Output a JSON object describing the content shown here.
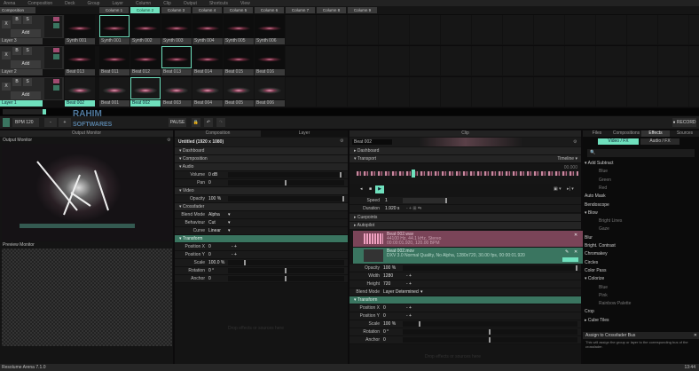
{
  "menu": [
    "Arena",
    "Composition",
    "Deck",
    "Group",
    "Layer",
    "Column",
    "Clip",
    "Output",
    "Shortcuts",
    "View"
  ],
  "composition_label": "Composition",
  "columns": [
    "Column 1",
    "Column 2",
    "Column 3",
    "Column 4",
    "Column 5",
    "Column 6",
    "Column 7",
    "Column 8",
    "Column 9"
  ],
  "selected_column": 1,
  "layers": [
    {
      "name": "Layer 3",
      "blend": "Add",
      "current": "Synth 001",
      "clips": [
        "Synth 001",
        "Synth 002",
        "Synth 003",
        "Synth 004",
        "Synth 005",
        "Synth 006"
      ],
      "selected_clip": 0,
      "active": false
    },
    {
      "name": "Layer 2",
      "blend": "Add",
      "current": "Beat 013",
      "clips": [
        "Beat 011",
        "Beat 012",
        "Beat 013",
        "Beat 014",
        "Beat 015",
        "Beat 016"
      ],
      "selected_clip": 2,
      "active": false
    },
    {
      "name": "Layer 1",
      "blend": "Add",
      "current": "Beat 002",
      "clips": [
        "Beat 001",
        "Beat 002",
        "Beat 003",
        "Beat 004",
        "Beat 005",
        "Beat 006"
      ],
      "selected_clip": 1,
      "active": true
    }
  ],
  "layer_buttons": {
    "bypass": "B",
    "solo": "S",
    "x": "X"
  },
  "toolbar": {
    "bpm_label": "BPM",
    "bpm": "120",
    "minus": "-",
    "plus": "+",
    "pause": "PAUSE",
    "record": "RECORD"
  },
  "monitor": {
    "tab": "Output Monitor",
    "output_title": "Output Monitor",
    "preview_title": "Preview Monitor"
  },
  "comp_panel": {
    "tabs": [
      "Composition",
      "Layer"
    ],
    "title": "Untitled (1920 x 1080)",
    "rows": [
      {
        "t": "sec",
        "label": "Dashboard"
      },
      {
        "t": "sec",
        "label": "Composition"
      },
      {
        "t": "sec",
        "label": "Audio"
      },
      {
        "t": "param",
        "label": "Volume",
        "value": "0 dB",
        "knob": 0.98
      },
      {
        "t": "param",
        "label": "Pan",
        "value": "0",
        "knob": 0.5
      },
      {
        "t": "sec",
        "label": "Video"
      },
      {
        "t": "param",
        "label": "Opacity",
        "value": "100 %",
        "knob": 1
      },
      {
        "t": "sec",
        "label": "Crossfader"
      },
      {
        "t": "drop",
        "label": "Blend Mode",
        "value": "Alpha"
      },
      {
        "t": "drop",
        "label": "Behaviour",
        "value": "Cut"
      },
      {
        "t": "drop",
        "label": "Curve",
        "value": "Linear"
      },
      {
        "t": "green",
        "label": "Transform"
      },
      {
        "t": "pm",
        "label": "Position X",
        "value": "0"
      },
      {
        "t": "pm",
        "label": "Position Y",
        "value": "0"
      },
      {
        "t": "param",
        "label": "Scale",
        "value": "100.0 %",
        "knob": 0.15
      },
      {
        "t": "param",
        "label": "Rotation",
        "value": "0 °",
        "knob": 0.5
      },
      {
        "t": "param",
        "label": "Anchor",
        "value": "0",
        "knob": 0.5
      }
    ],
    "drop_hint": "Drop effects or sources here"
  },
  "clip_panel": {
    "tab": "Clip",
    "name": "Beat 002",
    "dashboard": "Dashboard",
    "transport": "Transport",
    "timeline": "Timeline",
    "time": "00.000",
    "speed_label": "Speed",
    "speed": "1",
    "duration_label": "Duration",
    "duration": "1.920 s",
    "cuepoints": "Cuepoints",
    "autopilot": "Autopilot",
    "audio_item": {
      "name": "Beat 002.wav",
      "l1": "44100 Hz, 44.1 kHz, Stereo",
      "l2": "00:00:01.920, 120.00 BPM"
    },
    "video_item": {
      "name": "Beat 002.mov",
      "l1": "DXV 3.0 Normal Quality, No Alpha, 1280x720, 30.00 fps, 00:00:01.920"
    },
    "rows": [
      {
        "t": "param",
        "label": "Opacity",
        "value": "100 %",
        "knob": 1
      },
      {
        "t": "pm",
        "label": "Width",
        "value": "1280"
      },
      {
        "t": "pm",
        "label": "Height",
        "value": "720"
      },
      {
        "t": "drop",
        "label": "Blend Mode",
        "value": "Layer Determined"
      },
      {
        "t": "green",
        "label": "Transform"
      },
      {
        "t": "pm",
        "label": "Position X",
        "value": "0"
      },
      {
        "t": "pm",
        "label": "Position Y",
        "value": "0"
      },
      {
        "t": "param",
        "label": "Scale",
        "value": "100 %",
        "knob": 0.1
      },
      {
        "t": "param",
        "label": "Rotation",
        "value": "0 °",
        "knob": 0.5
      },
      {
        "t": "param",
        "label": "Anchor",
        "value": "0",
        "knob": 0.5
      }
    ],
    "drop_hint": "Drop effects or sources here"
  },
  "browser": {
    "tabs": [
      "Files",
      "Compositions",
      "Effects",
      "Sources"
    ],
    "active_tab": 2,
    "subtabs": [
      "Video / FX",
      "Audio / FX"
    ],
    "tree": [
      {
        "l": "▾ Add Subtract",
        "s": false
      },
      {
        "l": "Blue",
        "s": true
      },
      {
        "l": "Green",
        "s": true
      },
      {
        "l": "Red",
        "s": true
      },
      {
        "l": "Auto Mask",
        "s": false
      },
      {
        "l": "Bendoscope",
        "s": false
      },
      {
        "l": "▾ Blow",
        "s": false
      },
      {
        "l": "Bright Lines",
        "s": true
      },
      {
        "l": "Gaze",
        "s": true
      },
      {
        "l": "Blur",
        "s": false
      },
      {
        "l": "Bright. Contrast",
        "s": false
      },
      {
        "l": "Chromakey",
        "s": false
      },
      {
        "l": "Circles",
        "s": false
      },
      {
        "l": "Color Pass",
        "s": false
      },
      {
        "l": "▾ Colorize",
        "s": false
      },
      {
        "l": "Blue",
        "s": true
      },
      {
        "l": "Pink",
        "s": true
      },
      {
        "l": "Rainbow Palette",
        "s": true
      },
      {
        "l": "Crop",
        "s": false
      },
      {
        "l": "▸ Cube Tiles",
        "s": false
      }
    ],
    "help_title": "Assign to Crossfader Bus",
    "help_text": "This will assign the group or layer to the corresponding bus of the crossfader."
  },
  "status": {
    "app": "Resolume Arena 7.1.0",
    "time": "13:44"
  },
  "watermark": "RAHIM SOFTWARES",
  "colors": {
    "accent": "#6fe0bd",
    "transform": "#3a7560",
    "audio": "#8a4a60"
  }
}
